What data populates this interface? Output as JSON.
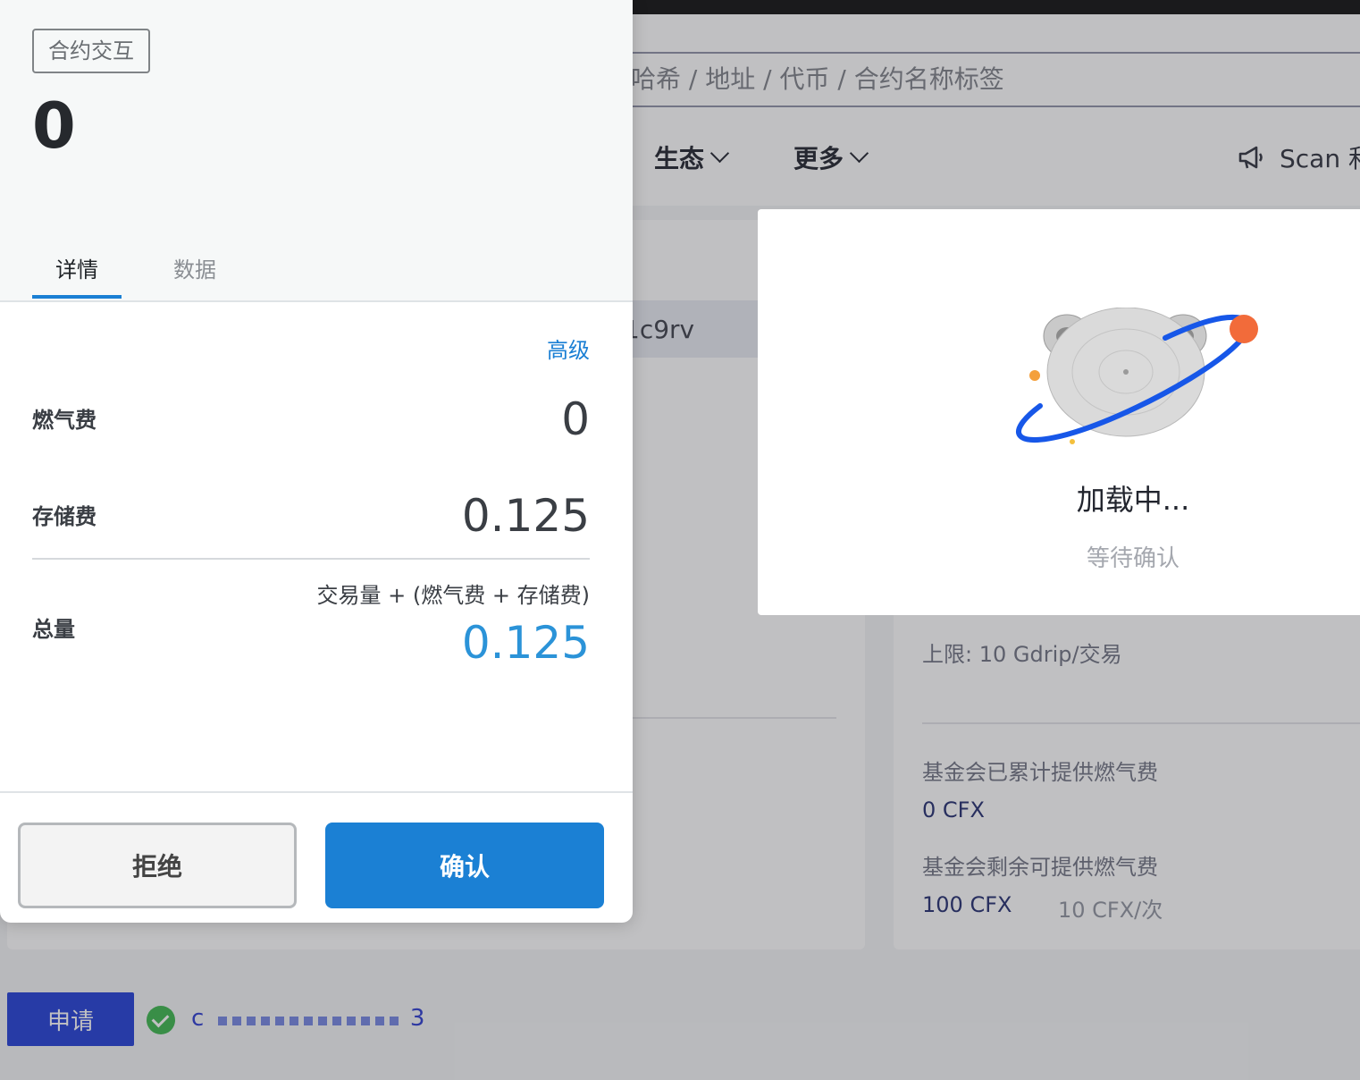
{
  "background": {
    "search_placeholder": "哈希 / 地址 / 代币 / 合约名称标签",
    "nav": [
      {
        "label": "生态"
      },
      {
        "label": "更多"
      }
    ],
    "scan_text": "Scan 和",
    "address_fragment": "1c9rv",
    "limit_label": "上限: 10 Gdrip/交易",
    "foundation_provided_label": "基金会已累计提供燃气费",
    "foundation_provided_value": "0 CFX",
    "foundation_remaining_label": "基金会剩余可提供燃气费",
    "foundation_remaining_value": "100 CFX",
    "per_time": "10 CFX/次",
    "apply_button": "申请",
    "address_start": "c",
    "address_end": "3"
  },
  "loading_modal": {
    "title": "加载中...",
    "subtitle": "等待确认"
  },
  "wallet": {
    "tag": "合约交互",
    "amount": "0",
    "tabs": [
      {
        "label": "详情",
        "active": true
      },
      {
        "label": "数据",
        "active": false
      }
    ],
    "advanced": "高级",
    "gas_fee_label": "燃气费",
    "gas_fee_value": "0",
    "storage_fee_label": "存储费",
    "storage_fee_value": "0.125",
    "total_label": "总量",
    "total_formula": "交易量 + (燃气费 + 存储费)",
    "total_value": "0.125",
    "reject_button": "拒绝",
    "confirm_button": "确认"
  },
  "colors": {
    "accent": "#1b80d4",
    "total_value": "#2b93d8",
    "apply_button": "#1e3bd6",
    "success": "#39b54a",
    "loader_orbit": "#1757e8",
    "loader_dot": "#f26b3a"
  }
}
